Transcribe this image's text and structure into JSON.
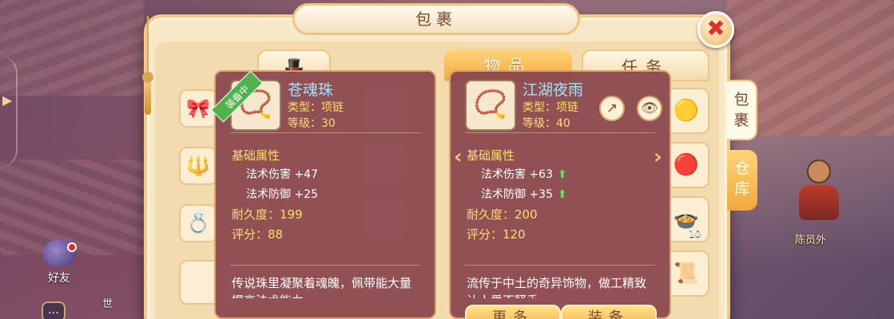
{
  "window": {
    "title": "包裹",
    "close_icon": "✖"
  },
  "tabs": {
    "items": "物品",
    "tasks": "任务"
  },
  "side_tabs": {
    "bag": "包裹",
    "storage": "仓库"
  },
  "hud": {
    "friends": "好友",
    "world": "世",
    "chat_icon": "…",
    "npc_name": "陈员外"
  },
  "compare": {
    "equipped": {
      "badge": "装备中",
      "name": "苍魂珠",
      "type": "类型：项链",
      "level": "等级：30",
      "section": "基础属性",
      "stats": [
        {
          "label": "法术伤害 +47",
          "up": false
        },
        {
          "label": "法术防御 +25",
          "up": false
        }
      ],
      "durability": "耐久度：199",
      "score": "评分：88",
      "description": "传说珠里凝聚着魂魄，佩带能大量提高法术能力。"
    },
    "candidate": {
      "name": "江湖夜雨",
      "type": "类型：项链",
      "level": "等级：40",
      "section": "基础属性",
      "stats": [
        {
          "label": "法术伤害 +63",
          "up": true
        },
        {
          "label": "法术防御 +35",
          "up": true
        }
      ],
      "durability": "耐久度：200",
      "score": "评分：120",
      "description": "流传于中土的奇异饰物，做工精致让人爱不释手。"
    }
  },
  "actions": {
    "more": "更多",
    "equip": "装备"
  },
  "grid_count": "10",
  "colors": {
    "accent_gold": "#f2a93c",
    "tooltip_bg": "#88444c",
    "stat_up": "#5fe05f",
    "name_blue": "#9fe4ff"
  }
}
